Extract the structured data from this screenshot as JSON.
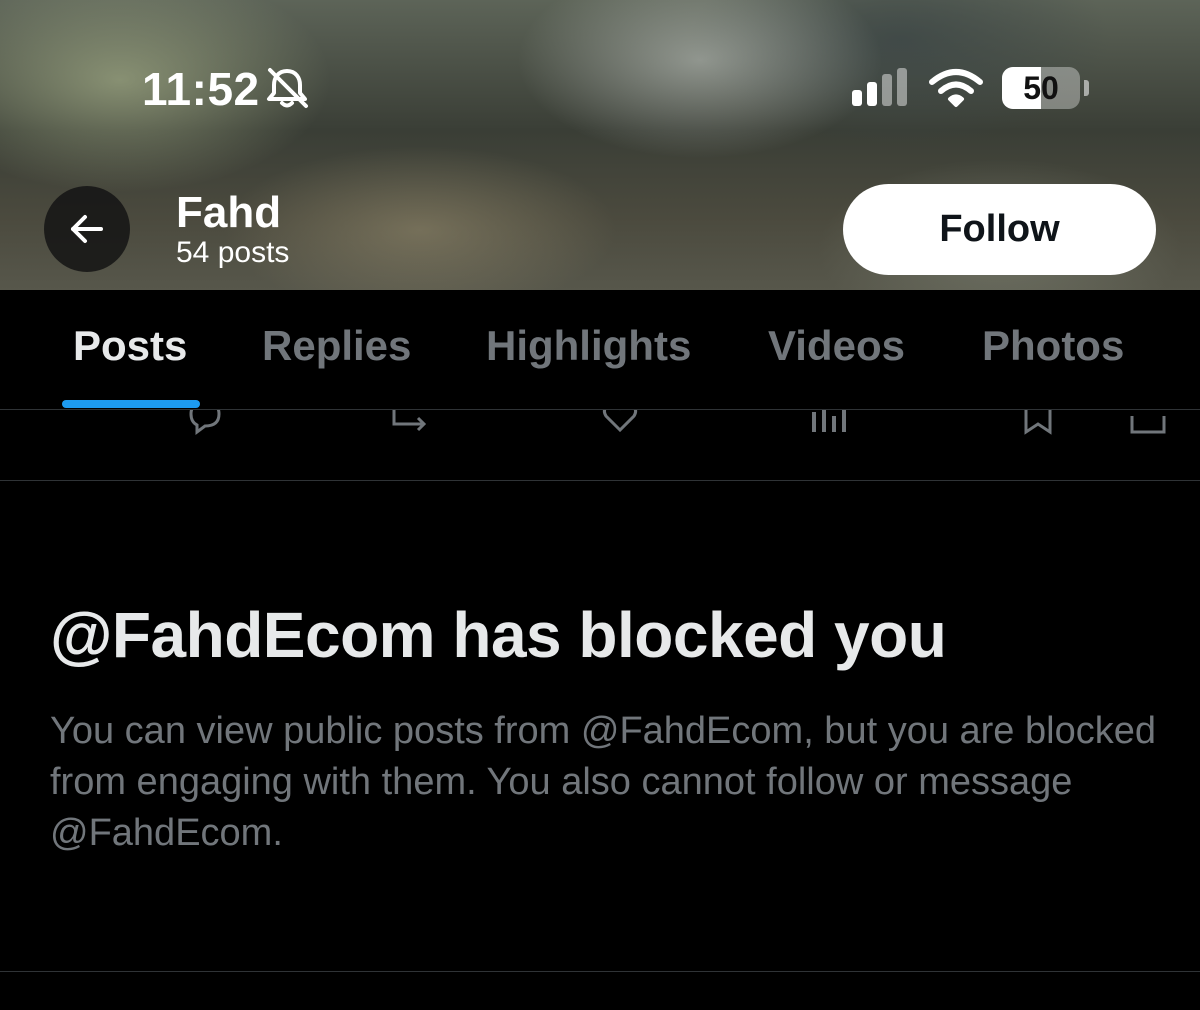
{
  "status_bar": {
    "time": "11:52",
    "battery_percent": "50",
    "battery_level": 0.5,
    "icons": [
      "bell-off-icon",
      "cellular-signal-icon",
      "wifi-icon",
      "battery-icon"
    ]
  },
  "header": {
    "back_icon": "arrow-left-icon",
    "name": "Fahd",
    "post_count": "54 posts",
    "follow_label": "Follow"
  },
  "tabs": [
    {
      "label": "Posts",
      "active": true
    },
    {
      "label": "Replies",
      "active": false
    },
    {
      "label": "Highlights",
      "active": false
    },
    {
      "label": "Videos",
      "active": false
    },
    {
      "label": "Photos",
      "active": false
    }
  ],
  "blocked": {
    "title": "@FahdEcom has blocked you",
    "message": "You can view public posts from @FahdEcom, but you are blocked from engaging with them. You also cannot follow or message @FahdEcom."
  },
  "colors": {
    "background": "#000000",
    "accent": "#1d9bf0",
    "text_primary": "#e7e9ea",
    "text_secondary": "#71767b",
    "divider": "#2f3336"
  }
}
